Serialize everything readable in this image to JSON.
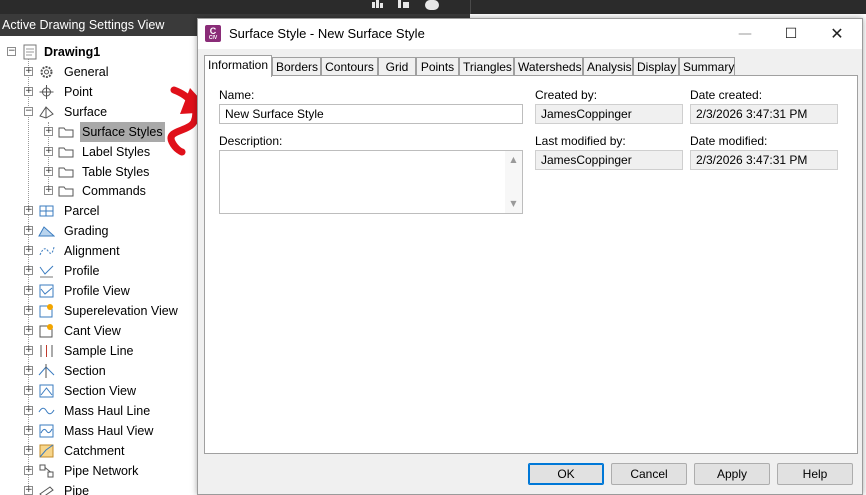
{
  "panel": {
    "title": "Active Drawing Settings View"
  },
  "tree": {
    "root": "Drawing1",
    "items": [
      {
        "label": "General",
        "icon": "gear-icon"
      },
      {
        "label": "Point",
        "icon": "point-icon"
      },
      {
        "label": "Surface",
        "icon": "surface-icon"
      },
      {
        "label": "Surface Styles",
        "icon": "folder-icon",
        "selected": true
      },
      {
        "label": "Label Styles",
        "icon": "folder-icon"
      },
      {
        "label": "Table Styles",
        "icon": "folder-icon"
      },
      {
        "label": "Commands",
        "icon": "folder-icon"
      },
      {
        "label": "Parcel",
        "icon": "parcel-icon"
      },
      {
        "label": "Grading",
        "icon": "grading-icon"
      },
      {
        "label": "Alignment",
        "icon": "alignment-icon"
      },
      {
        "label": "Profile",
        "icon": "profile-icon"
      },
      {
        "label": "Profile View",
        "icon": "profile-view-icon"
      },
      {
        "label": "Superelevation View",
        "icon": "superelevation-view-icon"
      },
      {
        "label": "Cant View",
        "icon": "cant-view-icon"
      },
      {
        "label": "Sample Line",
        "icon": "sample-line-icon"
      },
      {
        "label": "Section",
        "icon": "section-icon"
      },
      {
        "label": "Section View",
        "icon": "section-view-icon"
      },
      {
        "label": "Mass Haul Line",
        "icon": "mass-haul-line-icon"
      },
      {
        "label": "Mass Haul View",
        "icon": "mass-haul-view-icon"
      },
      {
        "label": "Catchment",
        "icon": "catchment-icon"
      },
      {
        "label": "Pipe Network",
        "icon": "pipe-network-icon"
      },
      {
        "label": "Pipe",
        "icon": "pipe-icon"
      }
    ]
  },
  "dialog": {
    "title": "Surface Style - New Surface Style",
    "app_icon_letter": "C",
    "app_icon_sub": "CIV",
    "tabs": [
      {
        "label": "Information",
        "active": true
      },
      {
        "label": "Borders"
      },
      {
        "label": "Contours"
      },
      {
        "label": "Grid"
      },
      {
        "label": "Points"
      },
      {
        "label": "Triangles"
      },
      {
        "label": "Watersheds"
      },
      {
        "label": "Analysis"
      },
      {
        "label": "Display"
      },
      {
        "label": "Summary"
      }
    ],
    "info": {
      "name_label": "Name:",
      "name_value": "New Surface Style",
      "description_label": "Description:",
      "description_value": "",
      "created_by_label": "Created by:",
      "created_by_value": "JamesCoppinger",
      "date_created_label": "Date created:",
      "date_created_value": "2/3/2026 3:47:31 PM",
      "last_modified_by_label": "Last modified by:",
      "last_modified_by_value": "JamesCoppinger",
      "date_modified_label": "Date modified:",
      "date_modified_value": "2/3/2026 3:47:31 PM"
    },
    "buttons": {
      "ok": "OK",
      "cancel": "Cancel",
      "apply": "Apply",
      "help": "Help"
    }
  },
  "colors": {
    "annotation_arrow": "#e0101a",
    "selection": "#a9a9a9",
    "panel_header": "#3a3a3a",
    "default_button_border": "#0078d7"
  }
}
